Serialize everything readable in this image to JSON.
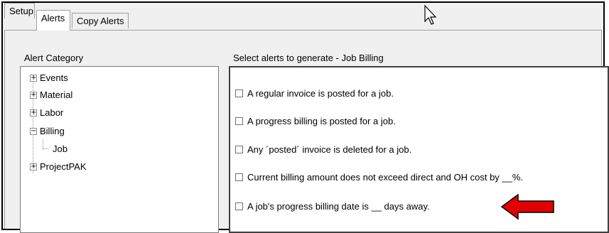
{
  "tabs": [
    "Setup",
    "Alerts",
    "Copy Alerts"
  ],
  "active_tab": "Alerts",
  "alert_category": {
    "label": "Alert Category",
    "items": [
      {
        "label": "Events",
        "expander": "+"
      },
      {
        "label": "Material",
        "expander": "+"
      },
      {
        "label": "Labor",
        "expander": "+"
      },
      {
        "label": "Billing",
        "expander": "−"
      },
      {
        "label": "Job",
        "expander": ""
      },
      {
        "label": "ProjectPAK",
        "expander": "+"
      }
    ],
    "selected": "Job"
  },
  "alerts": {
    "label": "Select alerts to generate - Job Billing",
    "items": [
      {
        "label": "A regular invoice is posted for a job.",
        "checked": false
      },
      {
        "label": "A progress billing is posted for a job.",
        "checked": false
      },
      {
        "label": "Any ´posted´ invoice is deleted for a job.",
        "checked": false
      },
      {
        "label": "Current billing amount does not exceed direct and OH cost by __%.",
        "checked": false
      },
      {
        "label": "A job's progress billing date is __ days away.",
        "checked": false
      }
    ]
  },
  "colors": {
    "arrow": "#e00000",
    "arrow_outline": "#000000"
  }
}
